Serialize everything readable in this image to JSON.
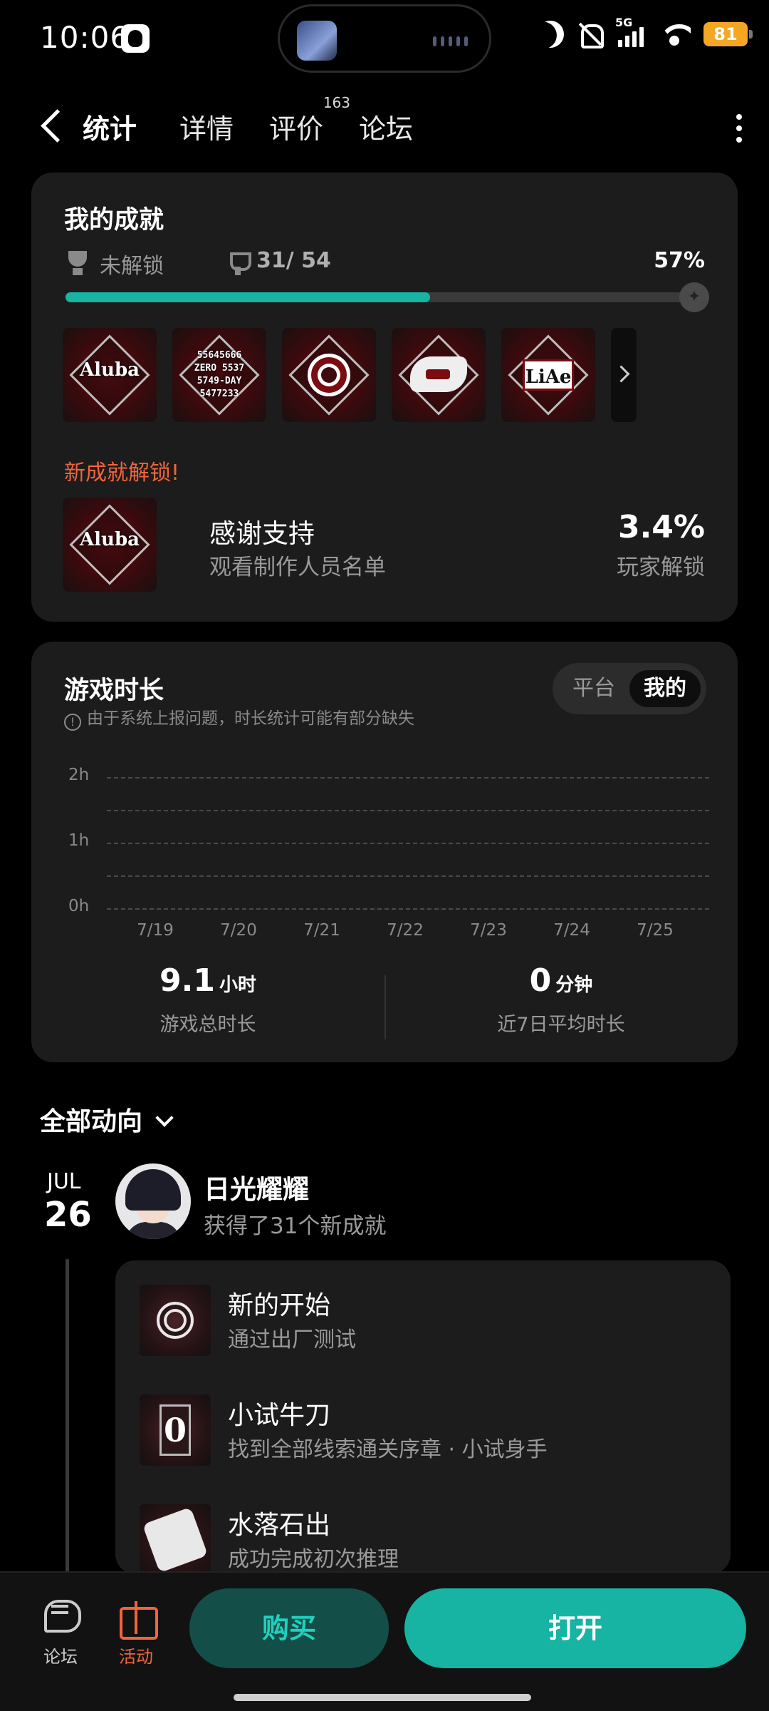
{
  "status_bar": {
    "time": "10:06",
    "network": "5G",
    "battery": "81"
  },
  "nav": {
    "tabs": [
      {
        "label": "统计",
        "active": true
      },
      {
        "label": "详情"
      },
      {
        "label": "评价",
        "badge": "163"
      },
      {
        "label": "论坛"
      }
    ]
  },
  "achievements": {
    "title": "我的成就",
    "locked_label": "未解锁",
    "count": "31/ 54",
    "percent_text": "57%",
    "progress": 0.57,
    "badges": [
      "Aluba",
      "ZERO 5537 5749-DAY 5477233",
      "target",
      "hand",
      "LiAe"
    ],
    "badge_texts": {
      "aluba": "Aluba",
      "zero": "55645666\nZERO 5537\n5749-DAY\n5477233",
      "liae": "LiAe"
    },
    "new_unlock_label": "新成就解锁!",
    "recent": {
      "name": "感谢支持",
      "desc": "观看制作人员名单",
      "rate": "3.4%",
      "rate_label": "玩家解锁"
    }
  },
  "playtime": {
    "title": "游戏时长",
    "segment": {
      "platform": "平台",
      "mine": "我的"
    },
    "notice": "由于系统上报问题，时长统计可能有部分缺失",
    "chart_data": {
      "type": "bar",
      "categories": [
        "7/19",
        "7/20",
        "7/21",
        "7/22",
        "7/23",
        "7/24",
        "7/25"
      ],
      "values": [
        0,
        0,
        0,
        0,
        0,
        0,
        0
      ],
      "y_ticks": [
        "2h",
        "1h",
        "0h"
      ],
      "ylim": [
        0,
        2
      ],
      "grid": true
    },
    "total": {
      "value": "9.1",
      "unit": "小时",
      "label": "游戏总时长"
    },
    "average": {
      "value": "0",
      "unit": "分钟",
      "label": "近7日平均时长"
    }
  },
  "feed": {
    "heading": "全部动向",
    "month": "JUL",
    "day": "26",
    "user": "日光耀耀",
    "action": "获得了31个新成就",
    "items": [
      {
        "title": "新的开始",
        "desc": "通过出厂测试"
      },
      {
        "title": "小试牛刀",
        "desc": "找到全部线索通关序章 · 小试身手"
      },
      {
        "title": "水落石出",
        "desc": "成功完成初次推理"
      }
    ]
  },
  "bottom_bar": {
    "forum": "论坛",
    "event": "活动",
    "buy": "购买",
    "open": "打开"
  },
  "colors": {
    "accent": "#17b3a3",
    "highlight": "#f2643c",
    "card": "#1c1c1c"
  }
}
